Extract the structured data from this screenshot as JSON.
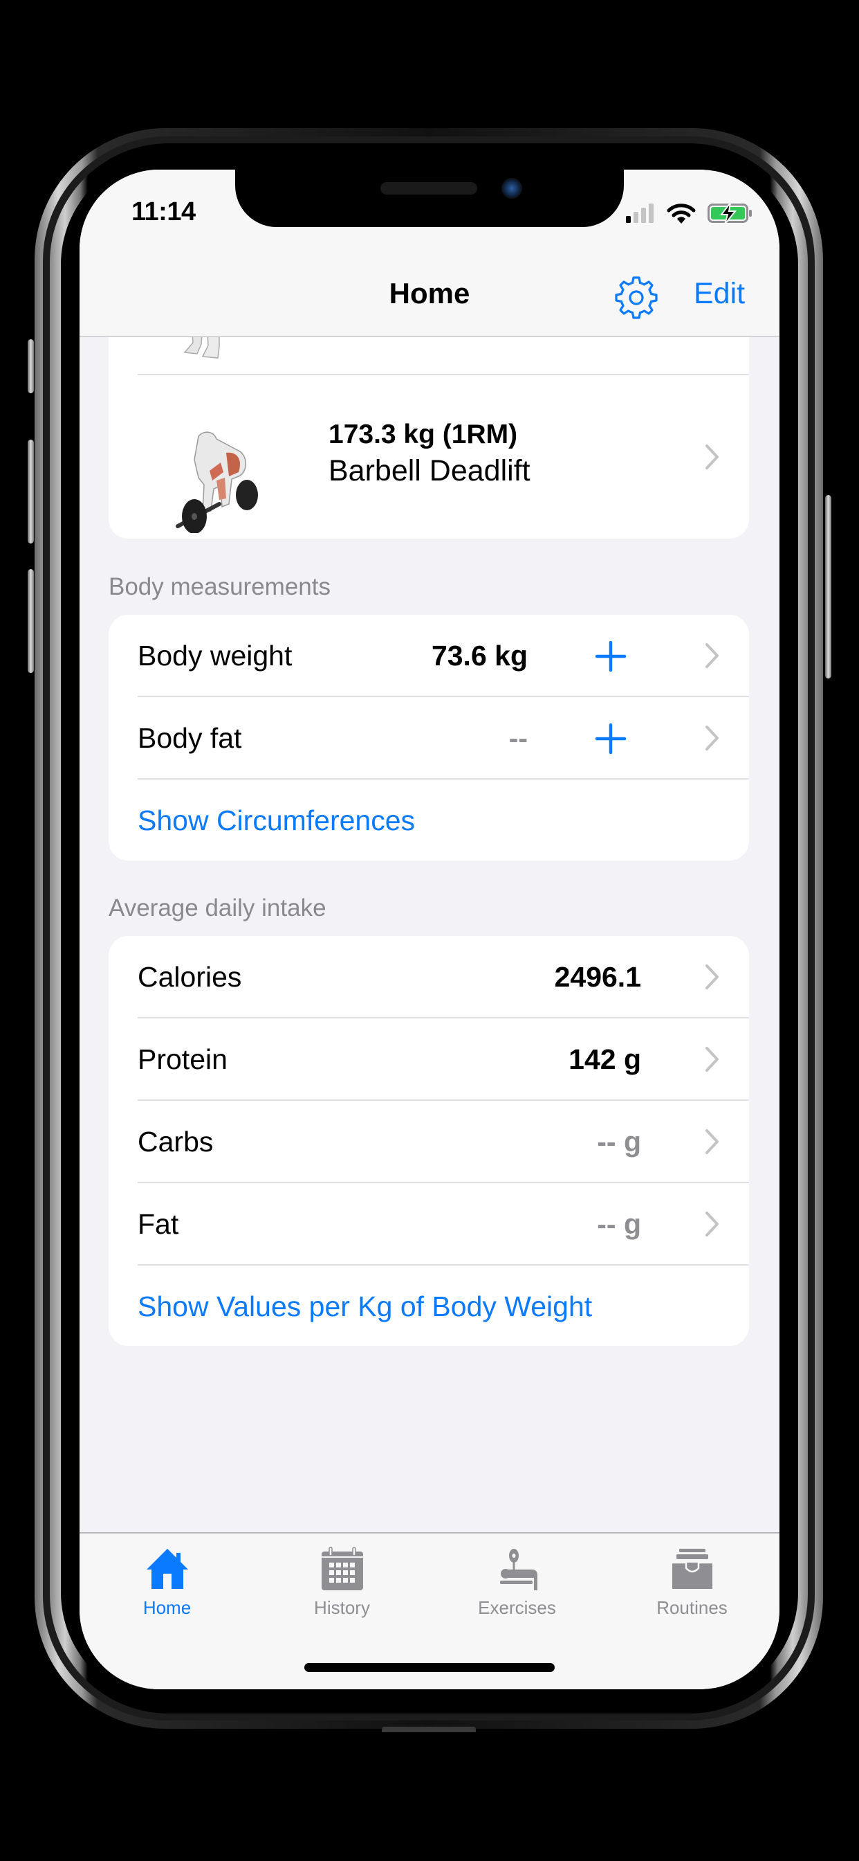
{
  "status_bar": {
    "time": "11:14",
    "signal": "signal-icon",
    "wifi": "wifi-icon",
    "battery": "battery-charging-icon"
  },
  "navbar": {
    "title": "Home",
    "settings_icon": "gear-icon",
    "edit_label": "Edit"
  },
  "exercises": {
    "items": [
      {
        "value": "",
        "name": "",
        "partially_visible": true
      },
      {
        "value": "173.3 kg (1RM)",
        "name": "Barbell Deadlift"
      }
    ]
  },
  "body_measurements": {
    "header": "Body measurements",
    "rows": [
      {
        "label": "Body weight",
        "value": "73.6 kg"
      },
      {
        "label": "Body fat",
        "value": "--"
      }
    ],
    "link": "Show Circumferences"
  },
  "daily_intake": {
    "header": "Average daily intake",
    "rows": [
      {
        "label": "Calories",
        "value": "2496.1",
        "muted": false
      },
      {
        "label": "Protein",
        "value": "142 g",
        "muted": false
      },
      {
        "label": "Carbs",
        "value": "-- g",
        "muted": true
      },
      {
        "label": "Fat",
        "value": "-- g",
        "muted": true
      }
    ],
    "link": "Show Values per Kg of Body Weight"
  },
  "tabbar": {
    "tabs": [
      {
        "label": "Home",
        "icon": "house-icon",
        "active": true
      },
      {
        "label": "History",
        "icon": "calendar-icon",
        "active": false
      },
      {
        "label": "Exercises",
        "icon": "bench-press-icon",
        "active": false
      },
      {
        "label": "Routines",
        "icon": "tray-icon",
        "active": false
      }
    ]
  },
  "colors": {
    "accent": "#0a7aff",
    "background": "#f2f2f7",
    "card": "#ffffff",
    "muted_text": "#8e8e93",
    "battery_fill": "#34c759"
  }
}
